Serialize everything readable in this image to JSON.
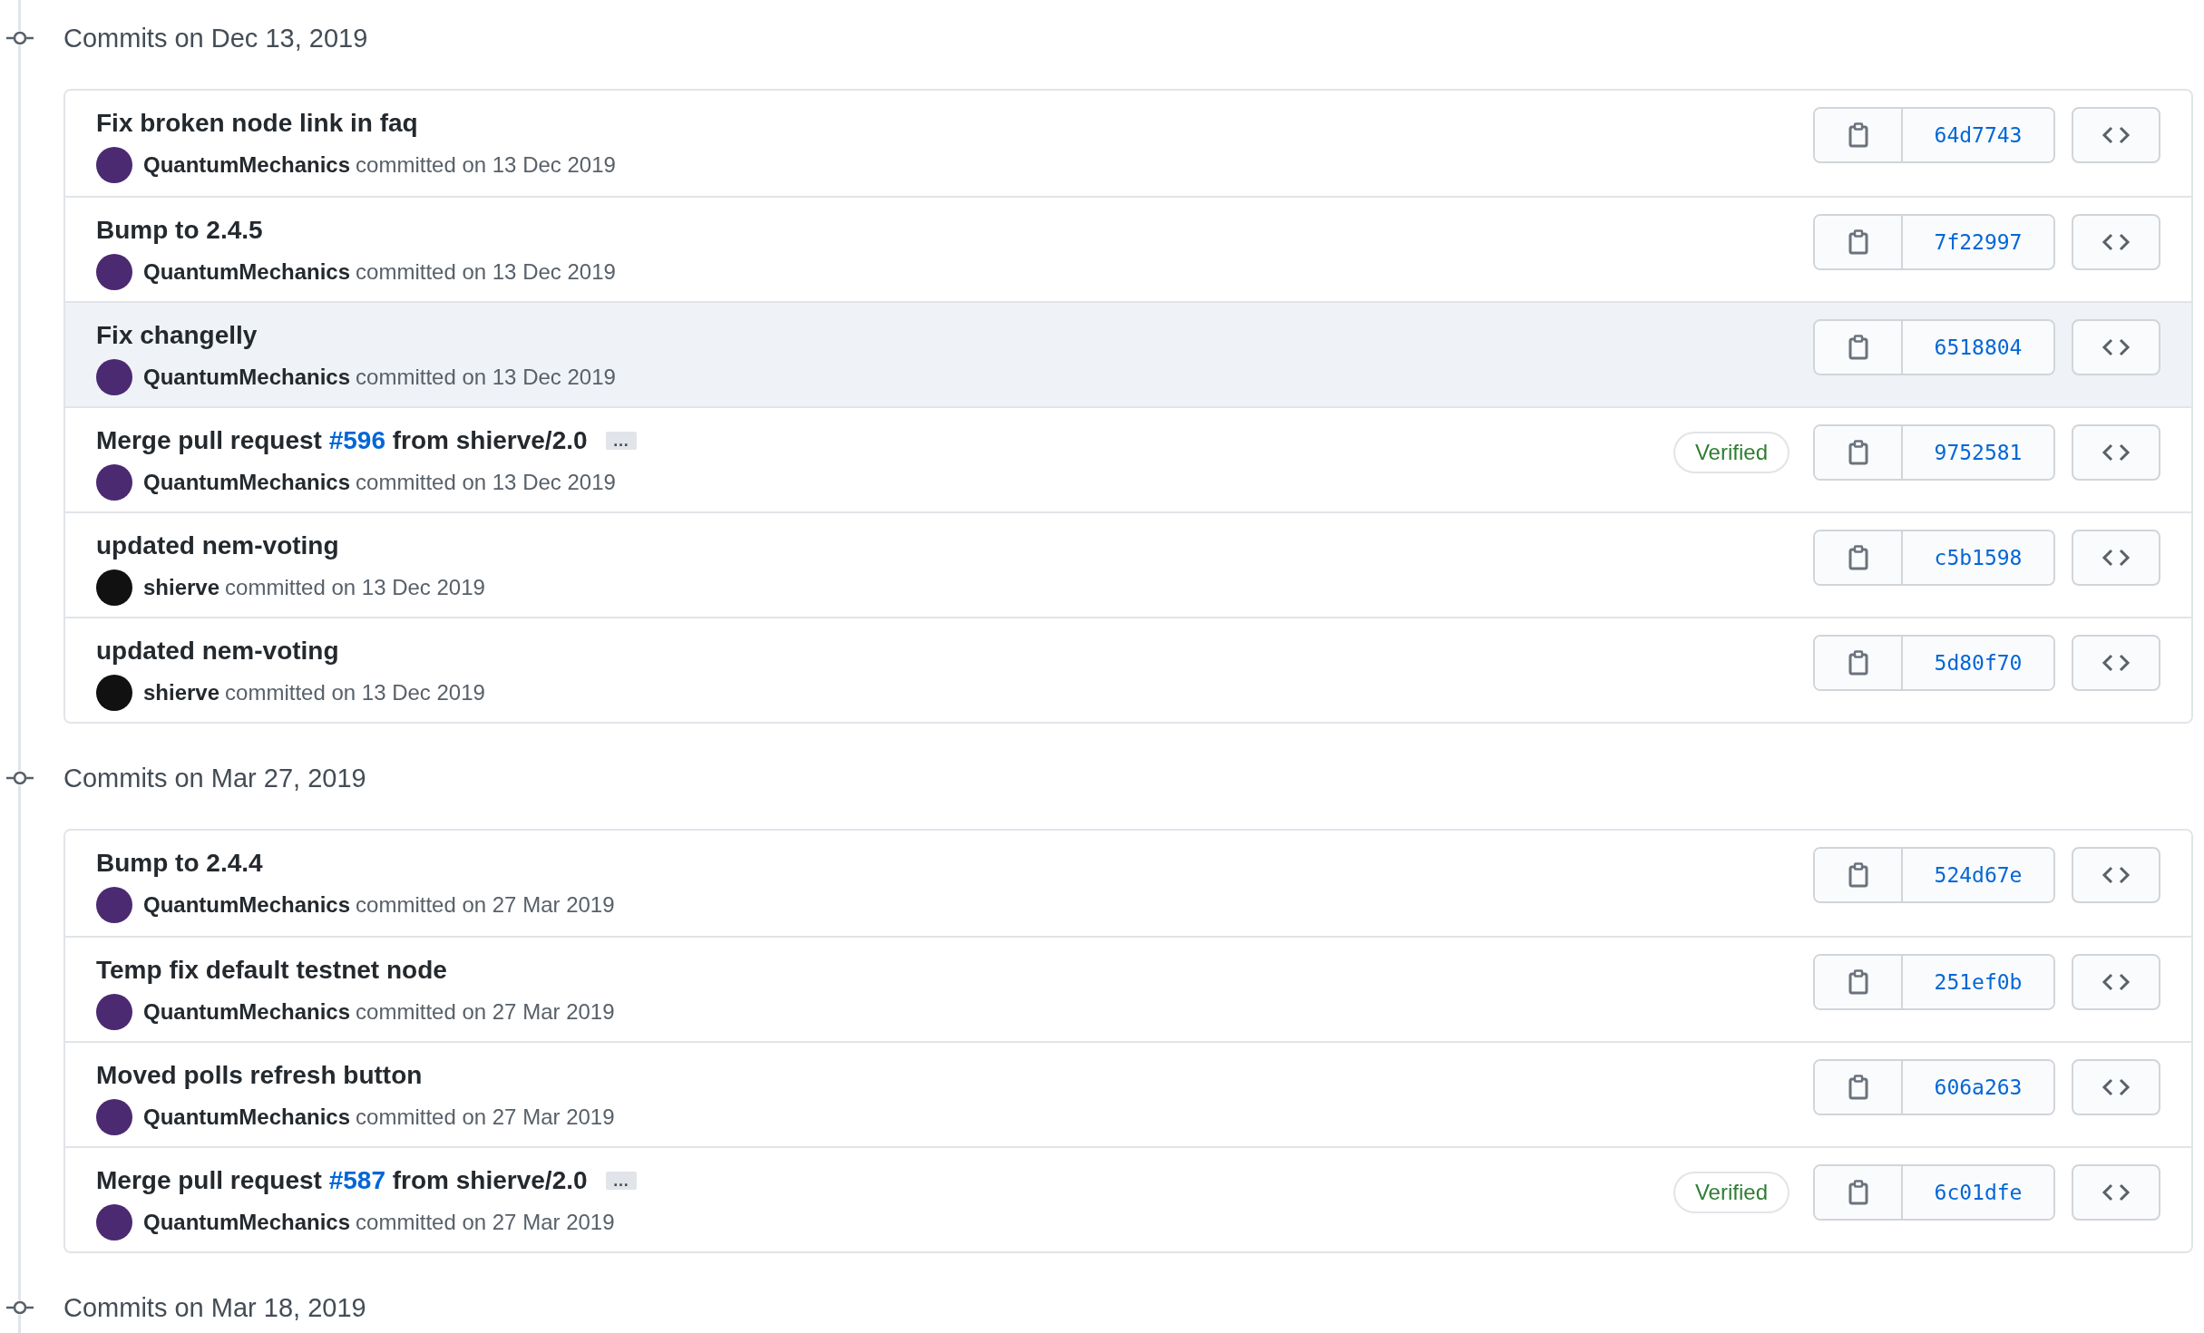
{
  "groups": [
    {
      "heading": "Commits on Dec 13, 2019",
      "commits": [
        {
          "title": "Fix broken node link in faq",
          "author": "QuantumMechanics",
          "color": "#4b2a72",
          "meta": "committed on 13 Dec 2019",
          "sha": "64d7743",
          "highlighted": false
        },
        {
          "title": "Bump to 2.4.5",
          "author": "QuantumMechanics",
          "color": "#4b2a72",
          "meta": "committed on 13 Dec 2019",
          "sha": "7f22997",
          "highlighted": false
        },
        {
          "title": "Fix changelly",
          "author": "QuantumMechanics",
          "color": "#4b2a72",
          "meta": "committed on 13 Dec 2019",
          "sha": "6518804",
          "highlighted": true
        },
        {
          "title": "Merge pull request ",
          "pr_link": "#596",
          "title_rest": " from shierve/2.0",
          "expander": "…",
          "badge": "Verified",
          "author": "QuantumMechanics",
          "color": "#4b2a72",
          "meta": "committed on 13 Dec 2019",
          "sha": "9752581",
          "highlighted": false
        },
        {
          "title": "updated nem-voting",
          "author": "shierve",
          "color": "#111111",
          "meta": "committed on 13 Dec 2019",
          "sha": "c5b1598",
          "highlighted": false
        },
        {
          "title": "updated nem-voting",
          "author": "shierve",
          "color": "#111111",
          "meta": "committed on 13 Dec 2019",
          "sha": "5d80f70",
          "highlighted": false
        }
      ]
    },
    {
      "heading": "Commits on Mar 27, 2019",
      "commits": [
        {
          "title": "Bump to 2.4.4",
          "author": "QuantumMechanics",
          "color": "#4b2a72",
          "meta": "committed on 27 Mar 2019",
          "sha": "524d67e",
          "highlighted": false
        },
        {
          "title": "Temp fix default testnet node",
          "author": "QuantumMechanics",
          "color": "#4b2a72",
          "meta": "committed on 27 Mar 2019",
          "sha": "251ef0b",
          "highlighted": false
        },
        {
          "title": "Moved polls refresh button",
          "author": "QuantumMechanics",
          "color": "#4b2a72",
          "meta": "committed on 27 Mar 2019",
          "sha": "606a263",
          "highlighted": false
        },
        {
          "title": "Merge pull request ",
          "pr_link": "#587",
          "title_rest": " from shierve/2.0",
          "expander": "…",
          "badge": "Verified",
          "author": "QuantumMechanics",
          "color": "#4b2a72",
          "meta": "committed on 27 Mar 2019",
          "sha": "6c01dfe",
          "highlighted": false
        }
      ]
    },
    {
      "heading": "Commits on Mar 18, 2019"
    }
  ]
}
